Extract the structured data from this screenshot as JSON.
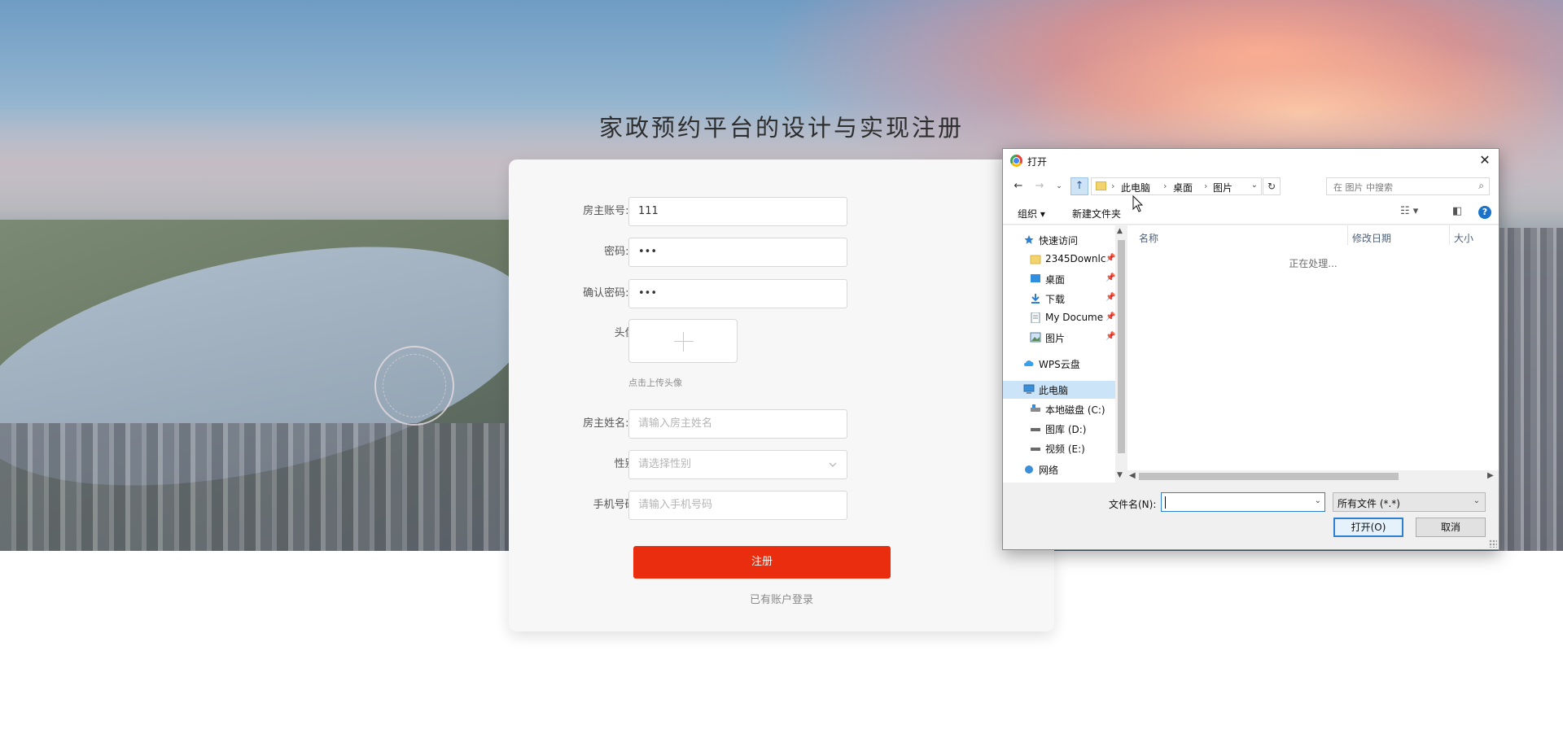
{
  "page": {
    "title": "家政预约平台的设计与实现注册"
  },
  "form": {
    "fields": [
      {
        "label": "房主账号:",
        "required": true,
        "value": "111",
        "placeholder": ""
      },
      {
        "label": "密码:",
        "required": true,
        "value": "•••",
        "placeholder": ""
      },
      {
        "label": "确认密码:",
        "required": true,
        "value": "•••",
        "placeholder": ""
      },
      {
        "label": "头像:",
        "required": false,
        "value": "",
        "placeholder": ""
      },
      {
        "label": "房主姓名:",
        "required": true,
        "value": "",
        "placeholder": "请输入房主姓名"
      },
      {
        "label": "性别:",
        "required": false,
        "value": "",
        "placeholder": "请选择性别"
      },
      {
        "label": "手机号码:",
        "required": false,
        "value": "",
        "placeholder": "请输入手机号码"
      }
    ],
    "required_mark": "*",
    "upload_hint": "点击上传头像",
    "submit_label": "注册",
    "login_link": "已有账户登录",
    "accent_color": "#ea2d0f"
  },
  "dialog": {
    "title": "打开",
    "close_glyph": "✕",
    "breadcrumbs": [
      "此电脑",
      "桌面",
      "图片"
    ],
    "search_placeholder": "在 图片 中搜索",
    "toolbar": {
      "organize": "组织 ▾",
      "new_folder": "新建文件夹",
      "help": "?"
    },
    "nav_items": [
      {
        "label": "快速访问",
        "icon": "star-icon",
        "pinned": false,
        "selected": false
      },
      {
        "label": "2345Downlc",
        "icon": "folder-icon",
        "pinned": true,
        "selected": false
      },
      {
        "label": "桌面",
        "icon": "desktop-icon",
        "pinned": true,
        "selected": false
      },
      {
        "label": "下载",
        "icon": "download-icon",
        "pinned": true,
        "selected": false
      },
      {
        "label": "My Docume",
        "icon": "document-icon",
        "pinned": true,
        "selected": false
      },
      {
        "label": "图片",
        "icon": "pictures-icon",
        "pinned": true,
        "selected": false
      },
      {
        "label": "WPS云盘",
        "icon": "cloud-icon",
        "pinned": false,
        "selected": false
      },
      {
        "label": "此电脑",
        "icon": "computer-icon",
        "pinned": false,
        "selected": true
      },
      {
        "label": "本地磁盘 (C:)",
        "icon": "drive-icon",
        "pinned": false,
        "selected": false
      },
      {
        "label": "图库 (D:)",
        "icon": "drive-icon",
        "pinned": false,
        "selected": false
      },
      {
        "label": "视频 (E:)",
        "icon": "drive-icon",
        "pinned": false,
        "selected": false
      },
      {
        "label": "网络",
        "icon": "network-icon",
        "pinned": false,
        "selected": false
      }
    ],
    "columns": [
      "名称",
      "修改日期",
      "大小"
    ],
    "status_text": "正在处理...",
    "filename_label": "文件名(N):",
    "filename_value": "",
    "filetype_value": "所有文件 (*.*)",
    "open_label": "打开(O)",
    "cancel_label": "取消"
  }
}
